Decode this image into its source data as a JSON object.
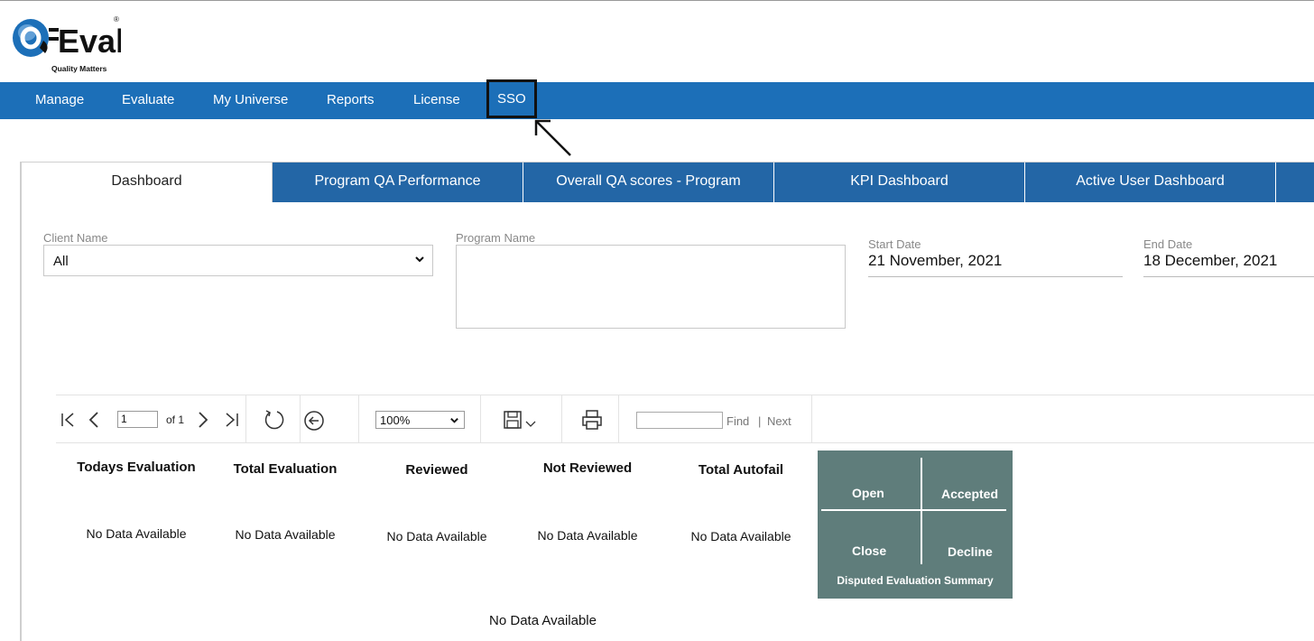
{
  "logo": {
    "brand": "QEval",
    "tagline": "Quality Matters",
    "mark": "®"
  },
  "nav": {
    "items": [
      {
        "label": "Manage"
      },
      {
        "label": "Evaluate"
      },
      {
        "label": "My Universe"
      },
      {
        "label": "Reports"
      },
      {
        "label": "License"
      },
      {
        "label": "SSO"
      }
    ]
  },
  "tabs": [
    {
      "label": "Dashboard",
      "active": true
    },
    {
      "label": "Program QA Performance",
      "active": false
    },
    {
      "label": "Overall QA scores - Program",
      "active": false
    },
    {
      "label": "KPI Dashboard",
      "active": false
    },
    {
      "label": "Active User Dashboard",
      "active": false
    }
  ],
  "filters": {
    "client_label": "Client Name",
    "client_value": "All",
    "program_label": "Program Name",
    "start_label": "Start Date",
    "start_value": "21 November, 2021",
    "end_label": "End Date",
    "end_value": "18 December, 2021"
  },
  "toolbar": {
    "page_value": "1",
    "of_text": "of 1",
    "zoom_value": "100%",
    "find_label": "Find",
    "divider": "|",
    "next_label": "Next"
  },
  "kpis": [
    {
      "title": "Todays Evaluation",
      "value": "No Data Available"
    },
    {
      "title": "Total Evaluation",
      "value": "No Data Available"
    },
    {
      "title": "Reviewed",
      "value": "No Data Available"
    },
    {
      "title": "Not Reviewed",
      "value": "No Data Available"
    },
    {
      "title": "Total Autofail",
      "value": "No Data Available"
    }
  ],
  "disputed": {
    "open": "Open",
    "accepted": "Accepted",
    "close": "Close",
    "decline": "Decline",
    "caption": "Disputed Evaluation Summary"
  },
  "bottom_message": "No Data Available",
  "colors": {
    "nav_bg": "#1c6fb8",
    "tab_bg": "#2366a6",
    "disputed_bg": "#5f7d7b"
  }
}
